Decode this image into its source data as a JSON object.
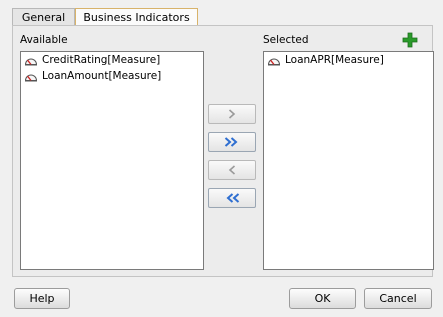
{
  "tabs": [
    {
      "label": "General"
    },
    {
      "label": "Business Indicators"
    }
  ],
  "available": {
    "label": "Available",
    "items": [
      {
        "label": "CreditRating[Measure]",
        "icon": "measure-icon"
      },
      {
        "label": "LoanAmount[Measure]",
        "icon": "measure-icon"
      }
    ]
  },
  "selected": {
    "label": "Selected",
    "items": [
      {
        "label": "LoanAPR[Measure]",
        "icon": "measure-icon"
      }
    ]
  },
  "move_buttons": {
    "move_right": {
      "icon": "chevron-right-icon",
      "enabled": false
    },
    "move_all_right": {
      "icon": "double-chevron-right-icon",
      "enabled": true
    },
    "move_left": {
      "icon": "chevron-left-icon",
      "enabled": false
    },
    "move_all_left": {
      "icon": "double-chevron-left-icon",
      "enabled": true
    }
  },
  "add_icon": "plus-icon",
  "footer": {
    "help": "Help",
    "ok": "OK",
    "cancel": "Cancel"
  },
  "colors": {
    "accent_blue": "#2f6fd1",
    "add_green": "#2a9a2a",
    "active_tab_border": "#d8b36a"
  }
}
